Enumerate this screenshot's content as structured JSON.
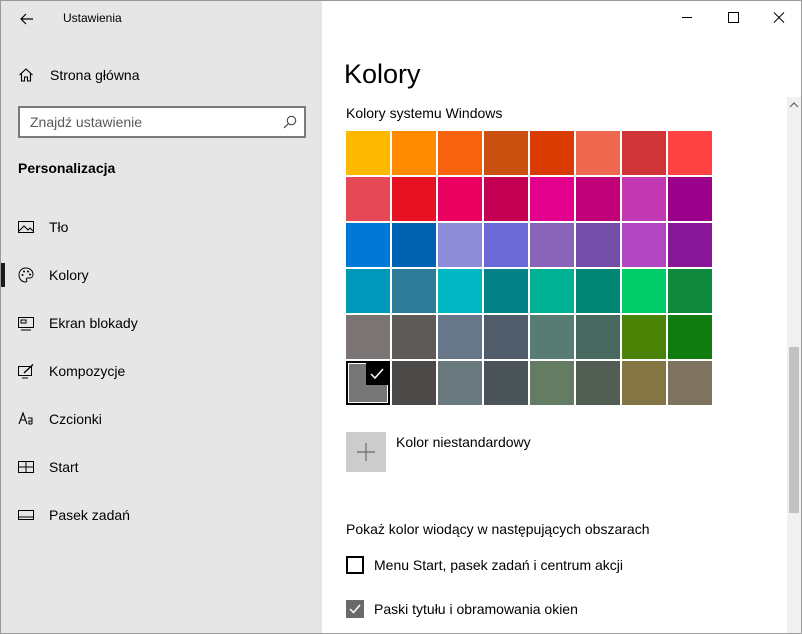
{
  "app": {
    "title": "Ustawienia"
  },
  "sidebar": {
    "home_label": "Strona główna",
    "search": {
      "placeholder": "Znajdź ustawienie",
      "value": ""
    },
    "section_heading": "Personalizacja",
    "items": [
      {
        "label": "Tło",
        "icon": "image-icon",
        "selected": false
      },
      {
        "label": "Kolory",
        "icon": "palette-icon",
        "selected": true
      },
      {
        "label": "Ekran blokady",
        "icon": "lock-screen-icon",
        "selected": false
      },
      {
        "label": "Kompozycje",
        "icon": "themes-icon",
        "selected": false
      },
      {
        "label": "Czcionki",
        "icon": "fonts-icon",
        "selected": false
      },
      {
        "label": "Start",
        "icon": "start-icon",
        "selected": false
      },
      {
        "label": "Pasek zadań",
        "icon": "taskbar-icon",
        "selected": false
      }
    ]
  },
  "main": {
    "page_title": "Kolory",
    "windows_colors_heading": "Kolory systemu Windows",
    "selected_swatch_index": 40,
    "swatches": [
      "#FFB900",
      "#FF8C00",
      "#F7630C",
      "#CA5010",
      "#DA3B01",
      "#EF6950",
      "#D13438",
      "#FF4343",
      "#E74856",
      "#E81123",
      "#EA005E",
      "#C30052",
      "#E3008C",
      "#BF0077",
      "#C239B3",
      "#9A0089",
      "#0078D7",
      "#0063B1",
      "#8E8CD8",
      "#6B69D6",
      "#8764B8",
      "#744DA9",
      "#B146C2",
      "#881798",
      "#0099BC",
      "#2D7D9A",
      "#00B7C3",
      "#038387",
      "#00B294",
      "#018574",
      "#00CC6A",
      "#10893E",
      "#7A7574",
      "#5D5A58",
      "#68768A",
      "#515C6B",
      "#567C73",
      "#486860",
      "#498205",
      "#107C10",
      "#767676",
      "#4C4A48",
      "#69797E",
      "#4A5459",
      "#647C64",
      "#525E54",
      "#847545",
      "#7E735F"
    ],
    "custom_color_label": "Kolor niestandardowy",
    "show_accent_heading": "Pokaż kolor wiodący w następujących obszarach",
    "checkboxes": [
      {
        "label": "Menu Start, pasek zadań i centrum akcji",
        "checked": false
      },
      {
        "label": "Paski tytułu i obramowania okien",
        "checked": true
      }
    ]
  }
}
